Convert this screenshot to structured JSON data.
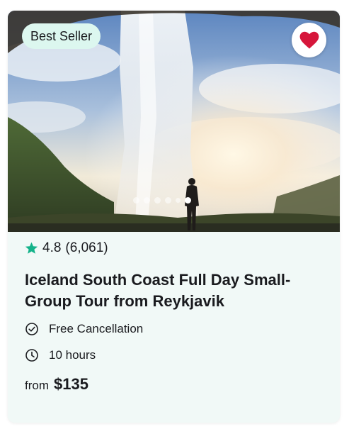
{
  "card": {
    "badge": "Best Seller",
    "favorite": {
      "active": true,
      "color": "#d6163b"
    },
    "carousel": {
      "count": 6,
      "active_index": 5
    },
    "rating": {
      "score": "4.8",
      "reviews": "(6,061)",
      "star_color": "#14b38a"
    },
    "title": "Iceland South Coast Full Day Small-Group Tour from Reykjavik",
    "features": [
      {
        "icon": "check-circle-icon",
        "label": "Free Cancellation"
      },
      {
        "icon": "clock-icon",
        "label": "10 hours"
      }
    ],
    "price": {
      "prefix": "from",
      "amount": "$135"
    }
  }
}
